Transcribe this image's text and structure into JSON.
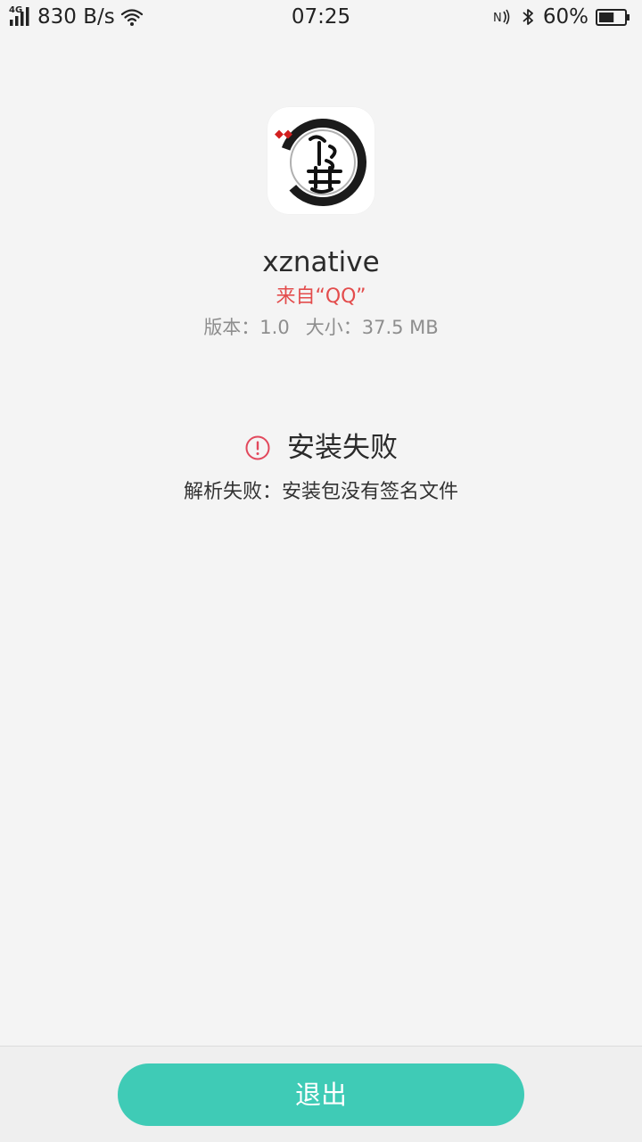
{
  "status_bar": {
    "network_type": "4G",
    "net_speed": "830 B/s",
    "time": "07:25",
    "battery": "60%",
    "battery_level": 0.6
  },
  "app": {
    "name": "xznative",
    "source": "来自“QQ”",
    "version": "版本：1.0",
    "size": "大小：37.5 MB"
  },
  "error": {
    "title": "安装失败",
    "detail": "解析失败：安装包没有签名文件"
  },
  "footer": {
    "exit_label": "退出"
  },
  "colors": {
    "accent": "#3fcbb6",
    "source_red": "#e34c4c",
    "error_icon": "#e2485c"
  },
  "icons": [
    "signal-icon",
    "wifi-icon",
    "nfc-icon",
    "bluetooth-icon",
    "battery-icon",
    "app-icon",
    "error-icon"
  ]
}
